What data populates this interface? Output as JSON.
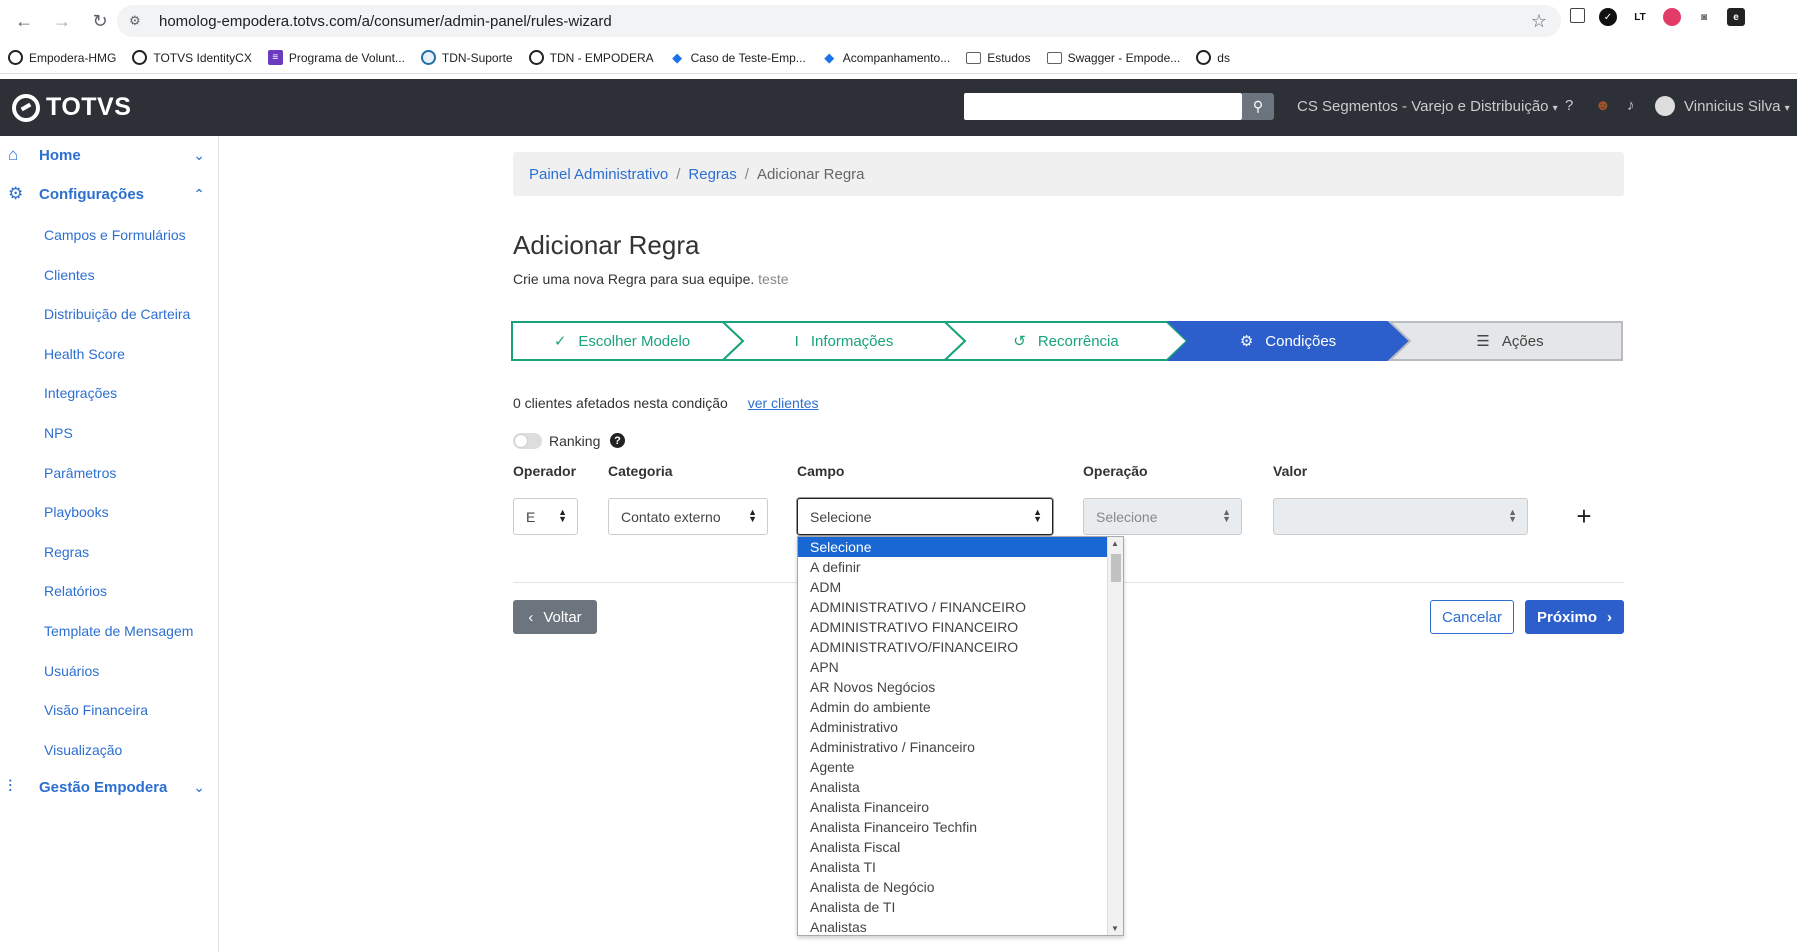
{
  "browser": {
    "url": "homolog-empodera.totvs.com/a/consumer/admin-panel/rules-wizard",
    "bookmarks": [
      "Empodera-HMG",
      "TOTVS IdentityCX",
      "Programa de Volunt...",
      "TDN-Suporte",
      "TDN - EMPODERA",
      "Caso de Teste-Emp...",
      "Acompanhamento...",
      "Estudos",
      "Swagger - Empode...",
      "ds"
    ]
  },
  "header": {
    "logo": "TOTVS",
    "segment": "CS Segmentos - Varejo e Distribuição",
    "user": "Vinnicius Silva"
  },
  "sidebar": {
    "home": "Home",
    "config": "Configurações",
    "items": [
      "Campos e Formulários",
      "Clientes",
      "Distribuição de Carteira",
      "Health Score",
      "Integrações",
      "NPS",
      "Parâmetros",
      "Playbooks",
      "Regras",
      "Relatórios",
      "Template de Mensagem",
      "Usuários",
      "Visão Financeira",
      "Visualização"
    ],
    "gestao": "Gestão Empodera"
  },
  "breadcrumb": [
    "Painel Administrativo",
    "Regras",
    "Adicionar Regra"
  ],
  "page": {
    "title": "Adicionar Regra",
    "subtitle": "Crie uma nova Regra para sua equipe.",
    "subtitle_extra": "teste"
  },
  "steps": [
    "Escolher Modelo",
    "Informações",
    "Recorrência",
    "Condições",
    "Ações"
  ],
  "conditions": {
    "affected": "0 clientes afetados nesta condição",
    "see_clients": "ver clientes",
    "ranking": "Ranking",
    "labels": {
      "operador": "Operador",
      "categoria": "Categoria",
      "campo": "Campo",
      "operacao": "Operação",
      "valor": "Valor"
    },
    "operador_value": "E",
    "categoria_value": "Contato externo",
    "campo_value": "Selecione",
    "operacao_value": "Selecione",
    "valor_value": ""
  },
  "buttons": {
    "back": "Voltar",
    "cancel": "Cancelar",
    "next": "Próximo"
  },
  "dropdown_options": [
    "Selecione",
    "A definir",
    "ADM",
    "ADMINISTRATIVO / FINANCEIRO",
    "ADMINISTRATIVO FINANCEIRO",
    "ADMINISTRATIVO/FINANCEIRO",
    "APN",
    "AR Novos Negócios",
    "Admin do ambiente",
    "Administrativo",
    "Administrativo / Financeiro",
    "Agente",
    "Analista",
    "Analista Financeiro",
    "Analista Financeiro Techfin",
    "Analista Fiscal",
    "Analista TI",
    "Analista de Negócio",
    "Analista de TI",
    "Analistas"
  ],
  "colors": {
    "primary": "#2d6fd0",
    "step_done": "#1aa37a",
    "step_active": "#2d5fcc",
    "header_bg": "#2d3036"
  }
}
